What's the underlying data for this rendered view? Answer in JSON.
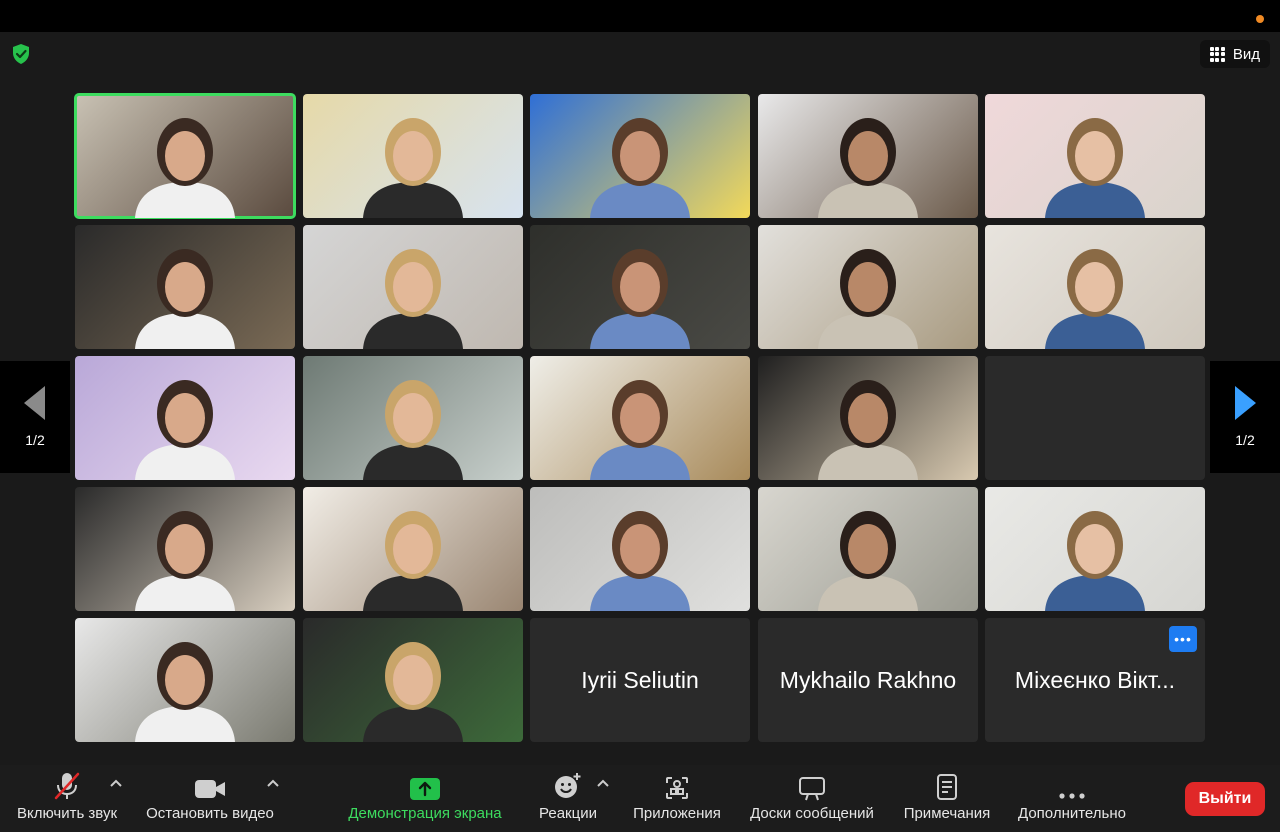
{
  "view_button": {
    "label": "Вид",
    "icon": "grid-icon"
  },
  "security_icon": "shield-check-icon",
  "pager": {
    "label": "1/2",
    "prev_icon": "chevron-left-icon",
    "next_icon": "chevron-right-icon"
  },
  "colors": {
    "accent_green": "#3ddc5f",
    "leave_red": "#e02828",
    "more_blue": "#1e7cf2",
    "next_arrow_blue": "#3aa0ff",
    "rec_orange": "#f08a24"
  },
  "participants": [
    {
      "type": "video",
      "active": true
    },
    {
      "type": "video"
    },
    {
      "type": "video"
    },
    {
      "type": "video"
    },
    {
      "type": "video"
    },
    {
      "type": "video"
    },
    {
      "type": "video"
    },
    {
      "type": "video"
    },
    {
      "type": "video"
    },
    {
      "type": "video"
    },
    {
      "type": "video"
    },
    {
      "type": "video"
    },
    {
      "type": "video"
    },
    {
      "type": "video"
    },
    {
      "type": "empty"
    },
    {
      "type": "video"
    },
    {
      "type": "video"
    },
    {
      "type": "video"
    },
    {
      "type": "video"
    },
    {
      "type": "video"
    },
    {
      "type": "video"
    },
    {
      "type": "video"
    },
    {
      "type": "name",
      "name": "Iyrii Seliutin"
    },
    {
      "type": "name",
      "name": "Mykhailo Rakhno"
    },
    {
      "type": "name",
      "name": "Міхеєнко Вікт...",
      "has_more": true
    }
  ],
  "toolbar": {
    "mute_label": "Включить звук",
    "video_label": "Остановить видео",
    "share_label": "Демонстрация экрана",
    "reactions_label": "Реакции",
    "apps_label": "Приложения",
    "whiteboards_label": "Доски сообщений",
    "notes_label": "Примечания",
    "more_label": "Дополнительно",
    "leave_label": "Выйти"
  }
}
